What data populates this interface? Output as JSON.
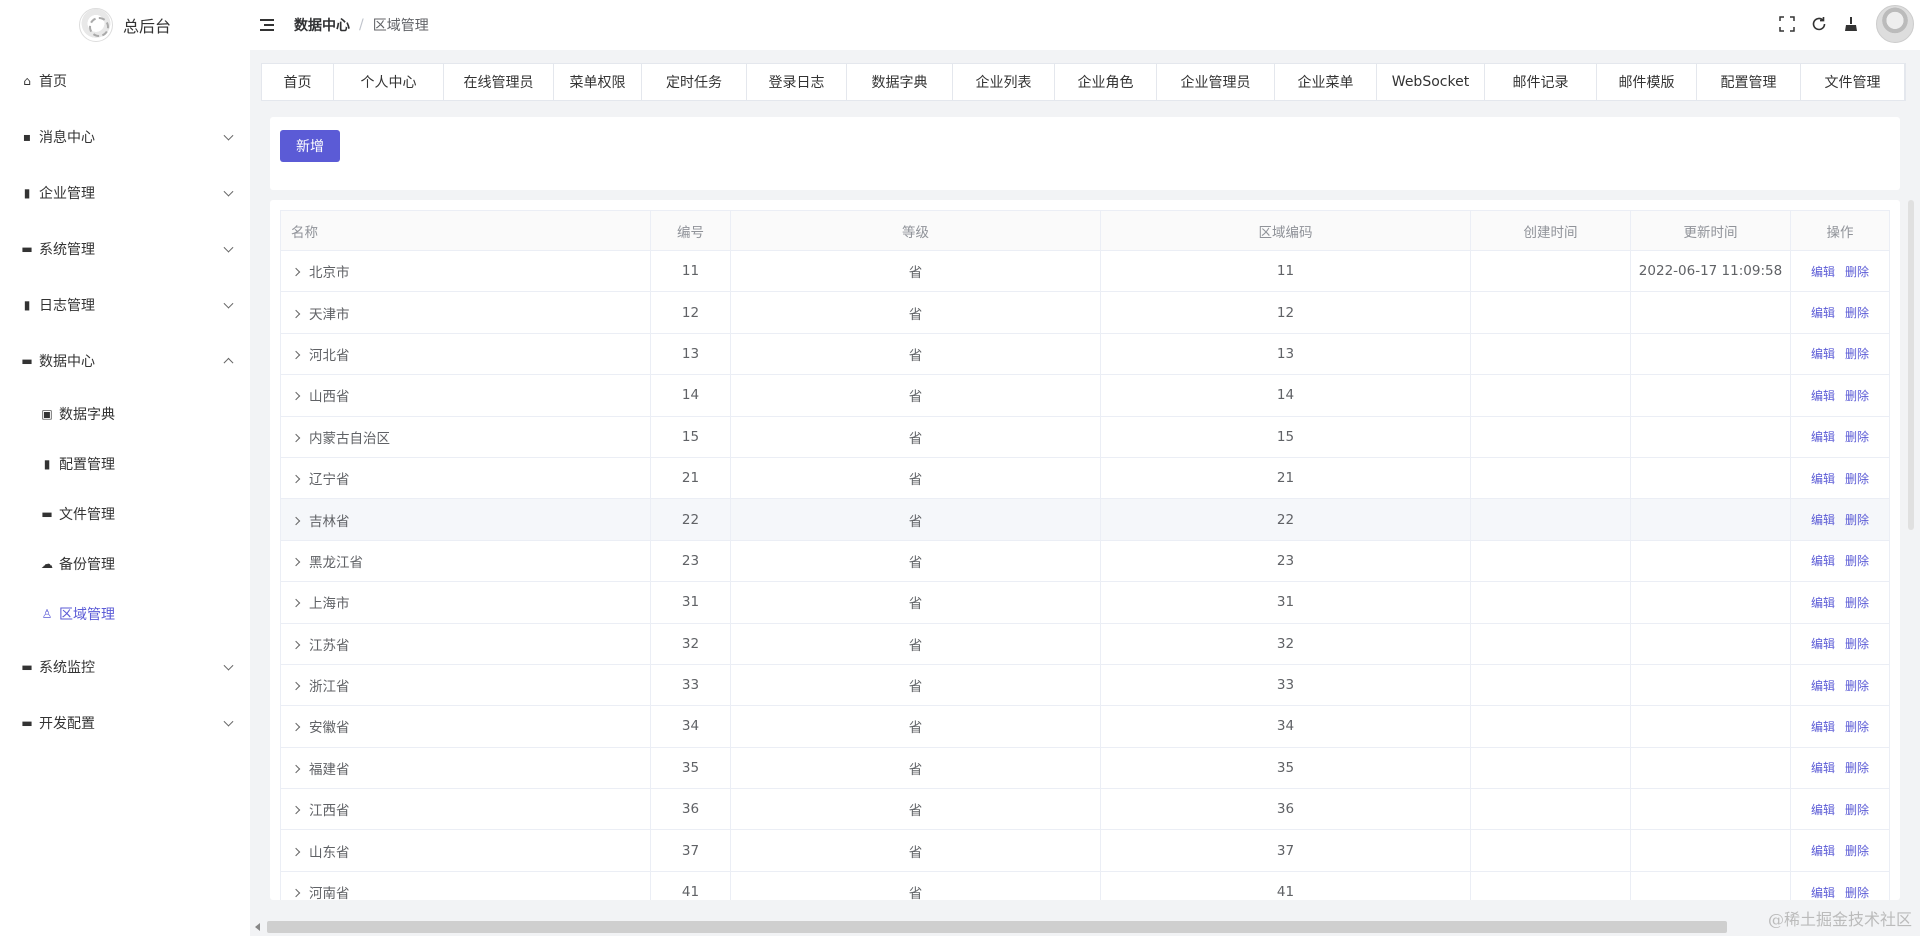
{
  "app": {
    "title": "总后台"
  },
  "sidebar": {
    "items": [
      {
        "label": "首页",
        "icon": "home-icon",
        "glyph": "⌂",
        "expandable": false
      },
      {
        "label": "消息中心",
        "icon": "chat-icon",
        "glyph": "▪",
        "expandable": true
      },
      {
        "label": "企业管理",
        "icon": "chart-icon",
        "glyph": "▮",
        "expandable": true
      },
      {
        "label": "系统管理",
        "icon": "monitor-icon",
        "glyph": "▬",
        "expandable": true
      },
      {
        "label": "日志管理",
        "icon": "log-icon",
        "glyph": "▮",
        "expandable": true
      },
      {
        "label": "数据中心",
        "icon": "monitor-icon",
        "glyph": "▬",
        "expandable": true,
        "open": true,
        "children": [
          {
            "label": "数据字典",
            "icon": "book-icon",
            "glyph": "▣"
          },
          {
            "label": "配置管理",
            "icon": "book-icon",
            "glyph": "▮"
          },
          {
            "label": "文件管理",
            "icon": "folder-icon",
            "glyph": "▬"
          },
          {
            "label": "备份管理",
            "icon": "cloud-icon",
            "glyph": "☁"
          },
          {
            "label": "区域管理",
            "icon": "user-icon",
            "glyph": "♙",
            "active": true
          }
        ]
      },
      {
        "label": "系统监控",
        "icon": "monitor-icon",
        "glyph": "▬",
        "expandable": true
      },
      {
        "label": "开发配置",
        "icon": "monitor-icon",
        "glyph": "▬",
        "expandable": true
      }
    ]
  },
  "header": {
    "breadcrumb": {
      "parent": "数据中心",
      "separator": "/",
      "current": "区域管理"
    },
    "icons": [
      "fullscreen-icon",
      "refresh-icon",
      "clean-icon"
    ]
  },
  "tags": [
    "首页",
    "个人中心",
    "在线管理员",
    "菜单权限",
    "定时任务",
    "登录日志",
    "数据字典",
    "企业列表",
    "企业角色",
    "企业管理员",
    "企业菜单",
    "WebSocket",
    "邮件记录",
    "邮件模版",
    "配置管理",
    "文件管理"
  ],
  "toolbar": {
    "add_label": "新增"
  },
  "table": {
    "columns": [
      "名称",
      "编号",
      "等级",
      "区域编码",
      "创建时间",
      "更新时间",
      "操作"
    ],
    "edit_label": "编辑",
    "delete_label": "删除",
    "rows": [
      {
        "name": "北京市",
        "code": "11",
        "level": "省",
        "area_code": "11",
        "created": "",
        "updated": "2022-06-17 11:09:58"
      },
      {
        "name": "天津市",
        "code": "12",
        "level": "省",
        "area_code": "12",
        "created": "",
        "updated": ""
      },
      {
        "name": "河北省",
        "code": "13",
        "level": "省",
        "area_code": "13",
        "created": "",
        "updated": ""
      },
      {
        "name": "山西省",
        "code": "14",
        "level": "省",
        "area_code": "14",
        "created": "",
        "updated": ""
      },
      {
        "name": "内蒙古自治区",
        "code": "15",
        "level": "省",
        "area_code": "15",
        "created": "",
        "updated": ""
      },
      {
        "name": "辽宁省",
        "code": "21",
        "level": "省",
        "area_code": "21",
        "created": "",
        "updated": ""
      },
      {
        "name": "吉林省",
        "code": "22",
        "level": "省",
        "area_code": "22",
        "created": "",
        "updated": "",
        "hover": true
      },
      {
        "name": "黑龙江省",
        "code": "23",
        "level": "省",
        "area_code": "23",
        "created": "",
        "updated": ""
      },
      {
        "name": "上海市",
        "code": "31",
        "level": "省",
        "area_code": "31",
        "created": "",
        "updated": ""
      },
      {
        "name": "江苏省",
        "code": "32",
        "level": "省",
        "area_code": "32",
        "created": "",
        "updated": ""
      },
      {
        "name": "浙江省",
        "code": "33",
        "level": "省",
        "area_code": "33",
        "created": "",
        "updated": ""
      },
      {
        "name": "安徽省",
        "code": "34",
        "level": "省",
        "area_code": "34",
        "created": "",
        "updated": ""
      },
      {
        "name": "福建省",
        "code": "35",
        "level": "省",
        "area_code": "35",
        "created": "",
        "updated": ""
      },
      {
        "name": "江西省",
        "code": "36",
        "level": "省",
        "area_code": "36",
        "created": "",
        "updated": ""
      },
      {
        "name": "山东省",
        "code": "37",
        "level": "省",
        "area_code": "37",
        "created": "",
        "updated": ""
      },
      {
        "name": "河南省",
        "code": "41",
        "level": "省",
        "area_code": "41",
        "created": "",
        "updated": ""
      }
    ]
  },
  "watermark": "@稀土掘金技术社区",
  "colors": {
    "accent": "#5b5bd6",
    "border": "#ebeef5",
    "muted_text": "#909399"
  }
}
